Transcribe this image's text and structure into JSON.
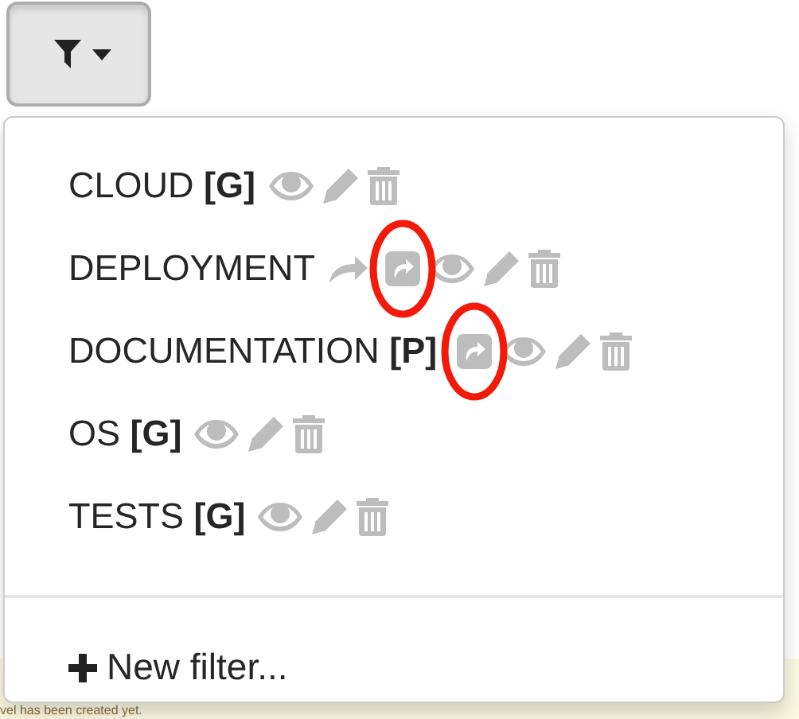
{
  "filter_button": {
    "expanded": true
  },
  "filters": [
    {
      "label": "CLOUD **[G]**",
      "shareable": false,
      "shared": false,
      "highlighted": false
    },
    {
      "label": "DEPLOYMENT",
      "shareable": true,
      "shared": true,
      "highlighted": true
    },
    {
      "label": "DOCUMENTATION **[P]**",
      "shareable": false,
      "shared": true,
      "highlighted": true
    },
    {
      "label": "OS **[G]**",
      "shareable": false,
      "shared": false,
      "highlighted": false
    },
    {
      "label": "TESTS **[G]**",
      "shareable": false,
      "shared": false,
      "highlighted": false
    }
  ],
  "new_filter": "New filter...",
  "background_notice": "vel has been created yet."
}
